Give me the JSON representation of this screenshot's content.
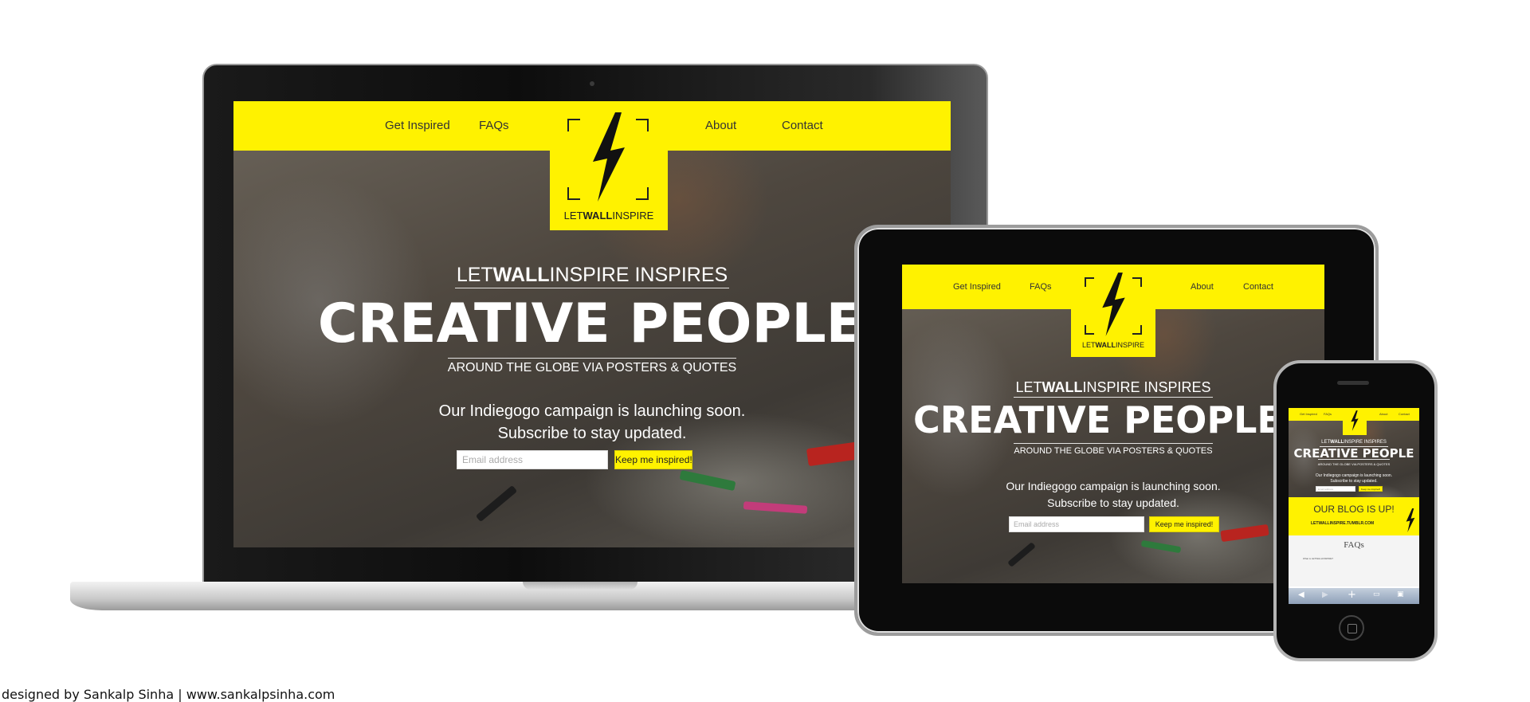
{
  "site": {
    "nav_left": [
      "Get Inspired",
      "FAQs"
    ],
    "nav_right": [
      "About",
      "Contact"
    ],
    "logo": {
      "prefix": "LET",
      "bold": "WALL",
      "suffix": "INSPIRE"
    },
    "inspires": {
      "prefix": "LET",
      "bold": "WALL",
      "suffix": "INSPIRE  INSPIRES"
    },
    "headline": "CREATIVE PEOPLE",
    "subheadline": "AROUND THE GLOBE VIA POSTERS & QUOTES",
    "campaign_line1": "Our Indiegogo campaign is launching soon.",
    "campaign_line2": "Subscribe to stay updated.",
    "email_placeholder": "Email address",
    "cta_label": "Keep me inspired!"
  },
  "phone": {
    "blog_banner": "OUR BLOG IS UP!",
    "blog_url": "LETWALLINSPIRE.TUMBLR.COM",
    "faqs_heading": "FAQs",
    "faq_item": "What is LETWALLINSPIRE?"
  },
  "credit": "designed by Sankalp Sinha | www.sankalpsinha.com",
  "colors": {
    "brand_yellow": "#fff200",
    "device_black": "#0b0b0b"
  }
}
